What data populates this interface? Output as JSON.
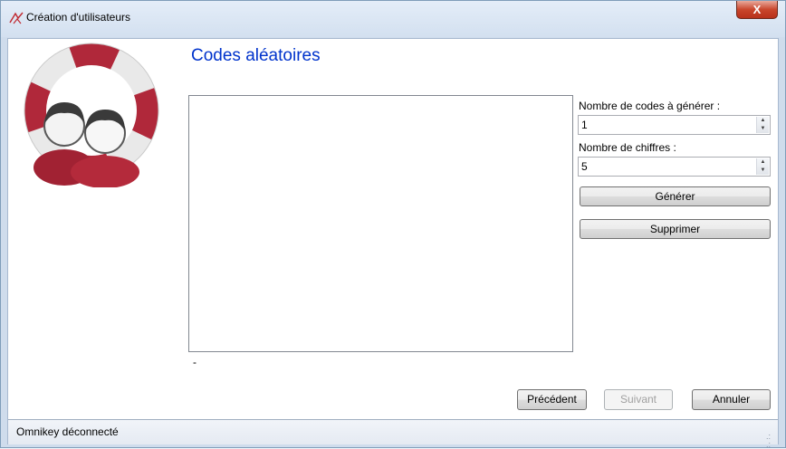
{
  "window": {
    "title": "Création d'utilisateurs",
    "close_label": "X"
  },
  "main": {
    "page_title": "Codes aléatoires",
    "codes_list": [],
    "list_footer": "-"
  },
  "settings": {
    "count_label": "Nombre de codes à générer :",
    "count_value": "1",
    "digits_label": "Nombre de chiffres :",
    "digits_value": "5",
    "generate_label": "Générer",
    "delete_label": "Supprimer"
  },
  "footer": {
    "previous_label": "Précédent",
    "next_label": "Suivant",
    "cancel_label": "Annuler"
  },
  "status": {
    "text": "Omnikey déconnecté"
  },
  "icons": {
    "window": "users-ring-icon",
    "logo": "users-lifebuoy-icon",
    "close": "close-icon"
  },
  "colors": {
    "title_text": "#0033cc",
    "logo_red": "#b0283a"
  }
}
